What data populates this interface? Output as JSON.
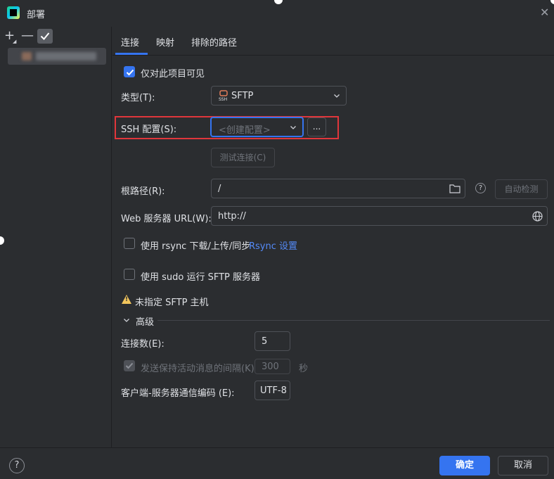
{
  "window": {
    "title": "部署"
  },
  "left_toolbar": {
    "add": "+",
    "remove": "—"
  },
  "tabs": [
    {
      "label": "连接",
      "active": true
    },
    {
      "label": "映射",
      "active": false
    },
    {
      "label": "排除的路径",
      "active": false
    }
  ],
  "connection": {
    "visible_only_this_project": {
      "label": "仅对此项目可见",
      "checked": true
    },
    "type": {
      "label": "类型(T):",
      "value": "SFTP",
      "icon": "ssh-icon"
    },
    "ssh_config": {
      "label": "SSH 配置(S):",
      "placeholder": "<创建配置>",
      "more_button": "..."
    },
    "test_connection_button": "测试连接(C)",
    "root_path": {
      "label": "根路径(R):",
      "value": "/",
      "auto_detect_button": "自动检测"
    },
    "web_url": {
      "label": "Web 服务器 URL(W):",
      "value": "http://"
    },
    "rsync": {
      "label": "使用 rsync 下载/上传/同步",
      "link": "Rsync 设置",
      "checked": false
    },
    "sudo": {
      "label": "使用 sudo 运行 SFTP 服务器",
      "checked": false
    },
    "warning": "未指定 SFTP 主机"
  },
  "advanced": {
    "header": "高级",
    "connections": {
      "label": "连接数(E):",
      "value": "5"
    },
    "keepalive": {
      "label": "发送保持活动消息的间隔(K):",
      "value": "300",
      "unit": "秒",
      "checked": true,
      "disabled": true
    },
    "encoding": {
      "label": "客户端-服务器通信编码 (E):",
      "value": "UTF-8"
    }
  },
  "footer": {
    "ok": "确定",
    "cancel": "取消",
    "help": "?"
  },
  "colors": {
    "accent": "#3574f0",
    "highlight_box": "#e0363b",
    "background": "#2b2d30",
    "warning": "#f2c55c",
    "link": "#548af7"
  }
}
